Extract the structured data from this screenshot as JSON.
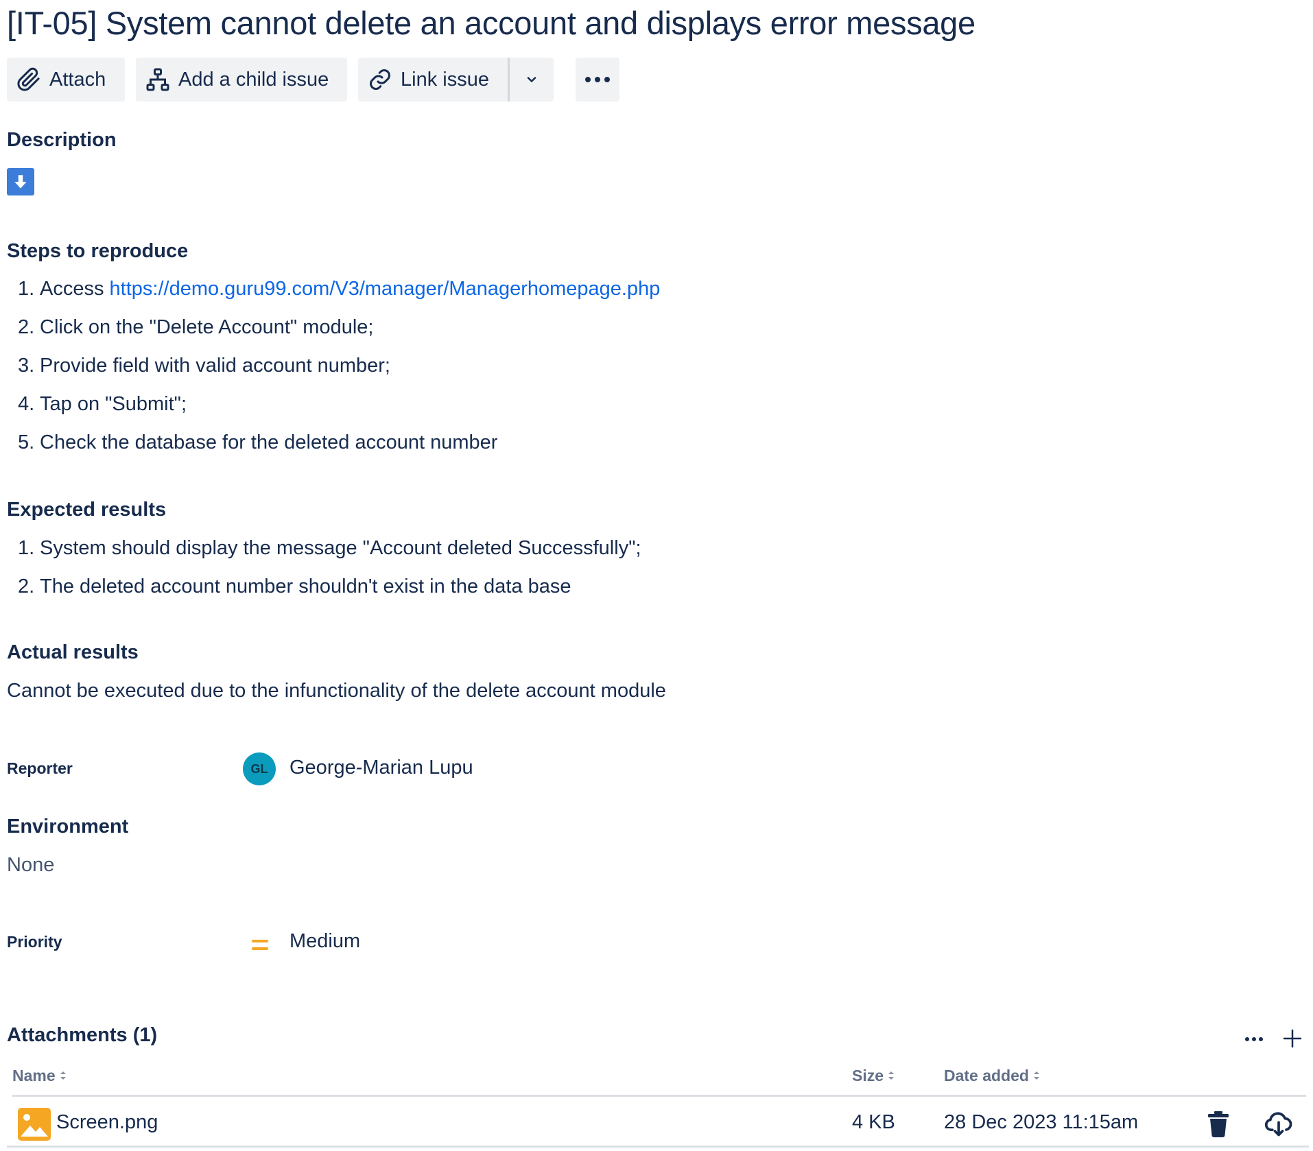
{
  "issue": {
    "title": "[IT-05] System cannot delete an account and displays error message"
  },
  "toolbar": {
    "attach_label": "Attach",
    "child_label": "Add a child issue",
    "link_label": "Link issue"
  },
  "description": {
    "heading": "Description",
    "icon": "arrow-down-icon",
    "steps_heading": "Steps to reproduce",
    "steps": [
      {
        "num": "1.",
        "prefix": "Access ",
        "link": "https://demo.guru99.com/V3/manager/Managerhomepage.php"
      },
      {
        "num": "2.",
        "text": "Click on the \"Delete Account\" module;"
      },
      {
        "num": "3.",
        "text": "Provide field with valid account number;"
      },
      {
        "num": "4.",
        "text": "Tap on \"Submit\";"
      },
      {
        "num": "5.",
        "text": "Check the database for the deleted account number"
      }
    ],
    "expected_heading": "Expected results",
    "expected": [
      {
        "num": "1.",
        "text": "System should display the message \"Account deleted Successfully\";"
      },
      {
        "num": "2.",
        "text": "The deleted account number shouldn't exist in the data base"
      }
    ],
    "actual_heading": "Actual results",
    "actual_text": "Cannot be executed due to the infunctionality of the delete account module"
  },
  "fields": {
    "reporter_label": "Reporter",
    "reporter_initials": "GL",
    "reporter_name": "George-Marian Lupu",
    "environment_label": "Environment",
    "environment_value": "None",
    "priority_label": "Priority",
    "priority_value": "Medium"
  },
  "attachments": {
    "title": "Attachments (1)",
    "columns": {
      "name": "Name",
      "size": "Size",
      "date": "Date added"
    },
    "files": [
      {
        "name": "Screen.png",
        "size": "4 KB",
        "date": "28 Dec 2023 11:15am"
      }
    ]
  },
  "colors": {
    "text": "#172b4d",
    "link": "#0c66e4",
    "button_bg": "#f1f2f4",
    "avatar": "#0a9bbd",
    "priority_medium": "#f5a623",
    "file_icon": "#f5a623",
    "desc_icon": "#3b7dd8"
  }
}
